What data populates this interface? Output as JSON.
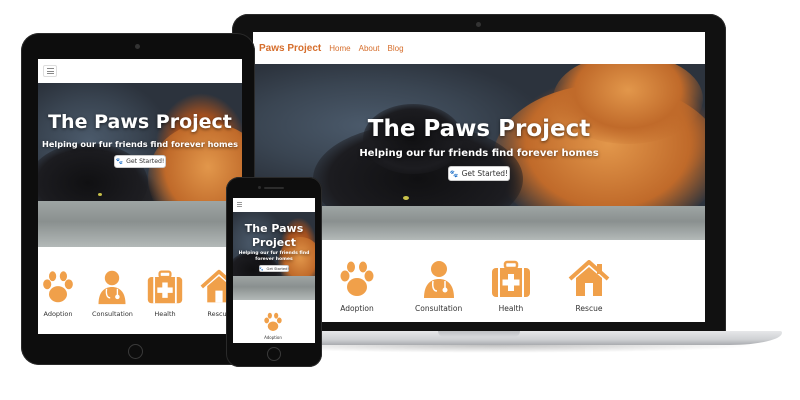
{
  "site": {
    "brand": "Paws Project",
    "nav": [
      "Home",
      "About",
      "Blog"
    ],
    "hero_title": "The Paws Project",
    "hero_title_phone": [
      "The Paws",
      "Project"
    ],
    "hero_subtitle": "Helping our fur friends find forever homes",
    "hero_subtitle_phone": [
      "Helping our fur friends find",
      "forever homes"
    ],
    "cta_label": "Get Started!",
    "services": [
      {
        "label": "Adoption",
        "icon": "paw-icon"
      },
      {
        "label": "Consultation",
        "icon": "doctor-icon"
      },
      {
        "label": "Health",
        "icon": "medical-kit-icon"
      },
      {
        "label": "Rescue",
        "icon": "house-icon"
      }
    ],
    "phone_service": "Adoption"
  },
  "colors": {
    "accent": "#d66e2c",
    "icon": "#f0a04a",
    "device": "#0d0d0d"
  }
}
